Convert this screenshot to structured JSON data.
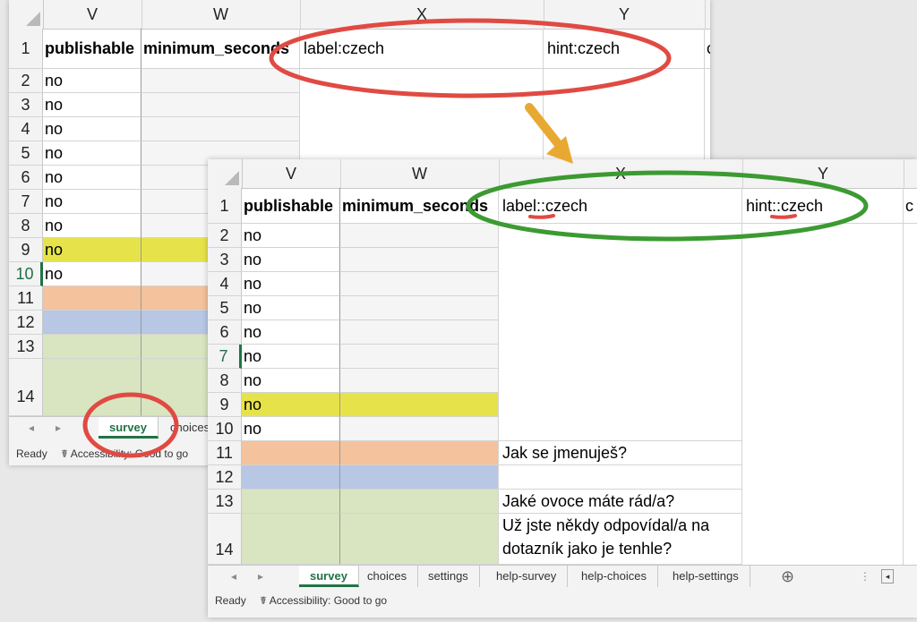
{
  "columns": [
    "V",
    "W",
    "X",
    "Y"
  ],
  "win1": {
    "headers": {
      "v": "publishable",
      "w": "minimum_seconds",
      "x": "label:czech",
      "y": "hint:czech",
      "z": "c"
    },
    "rows": [
      "1",
      "2",
      "3",
      "4",
      "5",
      "6",
      "7",
      "8",
      "9",
      "10",
      "11",
      "12",
      "13",
      "14"
    ],
    "v_values": [
      "no",
      "no",
      "no",
      "no",
      "no",
      "no",
      "no",
      "no",
      "no"
    ],
    "tabs": [
      "survey",
      "choices"
    ],
    "status_ready": "Ready",
    "status_accessibility": "Accessibility: Good to go"
  },
  "win2": {
    "headers": {
      "v": "publishable",
      "w": "minimum_seconds",
      "x": "label::czech",
      "y": "hint::czech",
      "z": "c"
    },
    "rows": [
      "1",
      "2",
      "3",
      "4",
      "5",
      "6",
      "7",
      "8",
      "9",
      "10",
      "11",
      "12",
      "13",
      "14"
    ],
    "v_values": [
      "no",
      "no",
      "no",
      "no",
      "no",
      "no",
      "no",
      "no",
      "no"
    ],
    "x_values": {
      "r11": "Jak se jmenuješ?",
      "r13": "Jaké ovoce máte rád/a?",
      "r14_line1": "Už jste někdy odpovídal/a na",
      "r14_line2": "dotazník jako je tenhle?"
    },
    "tabs": [
      "survey",
      "choices",
      "settings",
      "help-survey",
      "help-choices",
      "help-settings"
    ],
    "add_sheet": "⊕",
    "status_ready": "Ready",
    "status_accessibility": "Accessibility: Good to go"
  },
  "colors": {
    "yellow": "#e6e34a",
    "orange": "#f4c29c",
    "blue": "#b7c7e4",
    "green": "#d9e4c0",
    "excel_green": "#217346",
    "red_annotation": "#e04a43",
    "green_annotation": "#3c9a32",
    "arrow": "#e8a933"
  }
}
